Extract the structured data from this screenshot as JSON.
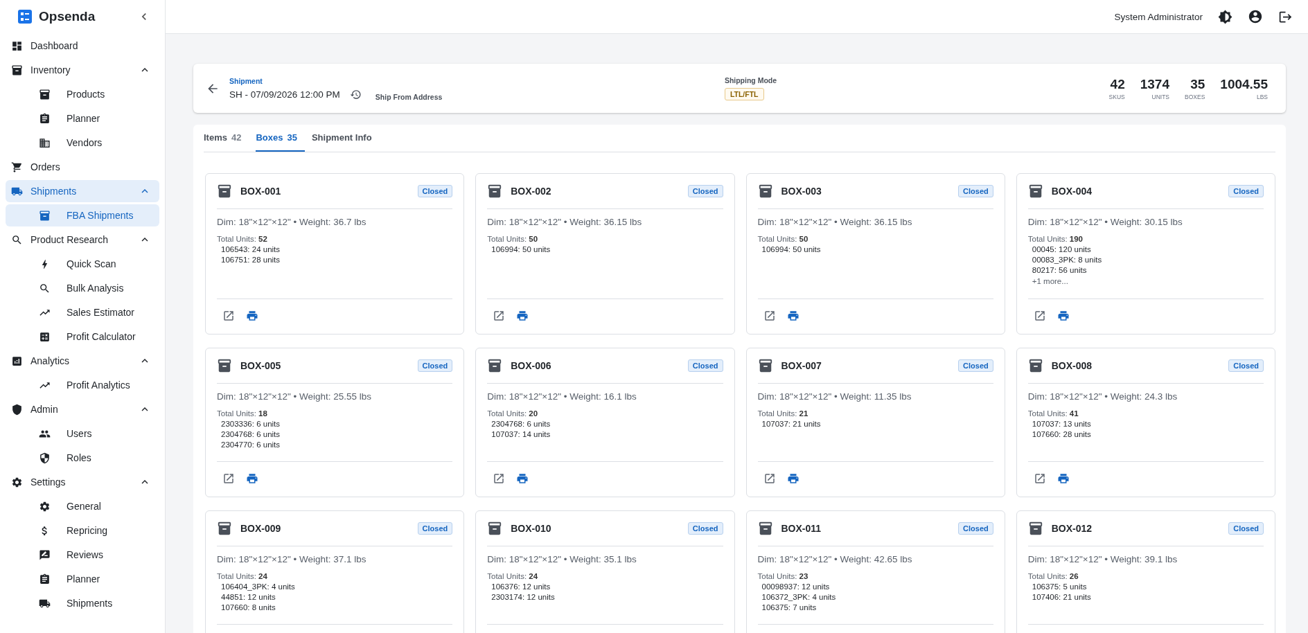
{
  "app": {
    "name": "Opsenda"
  },
  "sidebar": {
    "items": [
      {
        "label": "Dashboard",
        "selected": false
      },
      {
        "label": "Inventory",
        "selected": false,
        "expanded": true,
        "children": [
          {
            "label": "Products",
            "selected": false
          },
          {
            "label": "Planner",
            "selected": false
          },
          {
            "label": "Vendors",
            "selected": false
          }
        ]
      },
      {
        "label": "Orders",
        "selected": false
      },
      {
        "label": "Shipments",
        "selected": true,
        "expanded": true,
        "children": [
          {
            "label": "FBA Shipments",
            "selected": true
          }
        ]
      },
      {
        "label": "Product Research",
        "selected": false,
        "expanded": true,
        "children": [
          {
            "label": "Quick Scan",
            "selected": false
          },
          {
            "label": "Bulk Analysis",
            "selected": false
          },
          {
            "label": "Sales Estimator",
            "selected": false
          },
          {
            "label": "Profit Calculator",
            "selected": false
          }
        ]
      },
      {
        "label": "Analytics",
        "selected": false,
        "expanded": true,
        "children": [
          {
            "label": "Profit Analytics",
            "selected": false
          }
        ]
      },
      {
        "label": "Admin",
        "selected": false,
        "expanded": true,
        "children": [
          {
            "label": "Users",
            "selected": false
          },
          {
            "label": "Roles",
            "selected": false
          }
        ]
      },
      {
        "label": "Settings",
        "selected": false,
        "expanded": true,
        "children": [
          {
            "label": "General",
            "selected": false
          },
          {
            "label": "Repricing",
            "selected": false
          },
          {
            "label": "Reviews",
            "selected": false
          },
          {
            "label": "Planner",
            "selected": false
          },
          {
            "label": "Shipments",
            "selected": false
          }
        ]
      }
    ]
  },
  "topbar": {
    "user": "System Administrator"
  },
  "shipment": {
    "label": "Shipment",
    "name": "SH - 07/09/2026 12:00 PM",
    "ship_from_label": "Ship From Address",
    "shipping_mode_label": "Shipping Mode",
    "shipping_mode": "LTL/FTL",
    "stats": [
      {
        "value": "42",
        "label": "SKUS"
      },
      {
        "value": "1374",
        "label": "UNITS"
      },
      {
        "value": "35",
        "label": "BOXES"
      },
      {
        "value": "1004.55",
        "label": "LBS"
      }
    ]
  },
  "tabs": [
    {
      "label": "Items",
      "count": "42",
      "selected": false
    },
    {
      "label": "Boxes",
      "count": "35",
      "selected": true
    },
    {
      "label": "Shipment Info",
      "selected": false
    }
  ],
  "boxes": [
    {
      "name": "BOX-001",
      "status": "Closed",
      "details": "Dim: 18\"×12\"×12\" • Weight: 36.7 lbs",
      "total": "Total Units: **52**",
      "lines": [
        "106543: 24 units",
        "106751: 28 units"
      ]
    },
    {
      "name": "BOX-002",
      "status": "Closed",
      "details": "Dim: 18\"×12\"×12\" • Weight: 36.15 lbs",
      "total": "Total Units: **50**",
      "lines": [
        "106994: 50 units"
      ]
    },
    {
      "name": "BOX-003",
      "status": "Closed",
      "details": "Dim: 18\"×12\"×12\" • Weight: 36.15 lbs",
      "total": "Total Units: **50**",
      "lines": [
        "106994: 50 units"
      ]
    },
    {
      "name": "BOX-004",
      "status": "Closed",
      "details": "Dim: 18\"×12\"×12\" • Weight: 30.15 lbs",
      "total": "Total Units: **190**",
      "lines": [
        "00045: 120 units",
        "00083_3PK: 8 units",
        "80217: 56 units"
      ],
      "more": "+1 more..."
    },
    {
      "name": "BOX-005",
      "status": "Closed",
      "details": "Dim: 18\"×12\"×12\" • Weight: 25.55 lbs",
      "total": "Total Units: **18**",
      "lines": [
        "2303336: 6 units",
        "2304768: 6 units",
        "2304770: 6 units"
      ]
    },
    {
      "name": "BOX-006",
      "status": "Closed",
      "details": "Dim: 18\"×12\"×12\" • Weight: 16.1 lbs",
      "total": "Total Units: **20**",
      "lines": [
        "2304768: 6 units",
        "107037: 14 units"
      ]
    },
    {
      "name": "BOX-007",
      "status": "Closed",
      "details": "Dim: 18\"×12\"×12\" • Weight: 11.35 lbs",
      "total": "Total Units: **21**",
      "lines": [
        "107037: 21 units"
      ]
    },
    {
      "name": "BOX-008",
      "status": "Closed",
      "details": "Dim: 18\"×12\"×12\" • Weight: 24.3 lbs",
      "total": "Total Units: **41**",
      "lines": [
        "107037: 13 units",
        "107660: 28 units"
      ]
    },
    {
      "name": "BOX-009",
      "status": "Closed",
      "details": "Dim: 18\"×12\"×12\" • Weight: 37.1 lbs",
      "total": "Total Units: **24**",
      "lines": [
        "106404_3PK: 4 units",
        "44851: 12 units",
        "107660: 8 units"
      ]
    },
    {
      "name": "BOX-010",
      "status": "Closed",
      "details": "Dim: 18\"×12\"×12\" • Weight: 35.1 lbs",
      "total": "Total Units: **24**",
      "lines": [
        "106376: 12 units",
        "2303174: 12 units"
      ]
    },
    {
      "name": "BOX-011",
      "status": "Closed",
      "details": "Dim: 18\"×12\"×12\" • Weight: 42.65 lbs",
      "total": "Total Units: **23**",
      "lines": [
        "00098937: 12 units",
        "106372_3PK: 4 units",
        "106375: 7 units"
      ]
    },
    {
      "name": "BOX-012",
      "status": "Closed",
      "details": "Dim: 18\"×12\"×12\" • Weight: 39.1 lbs",
      "total": "Total Units: **26**",
      "lines": [
        "106375: 5 units",
        "107406: 21 units"
      ]
    }
  ]
}
